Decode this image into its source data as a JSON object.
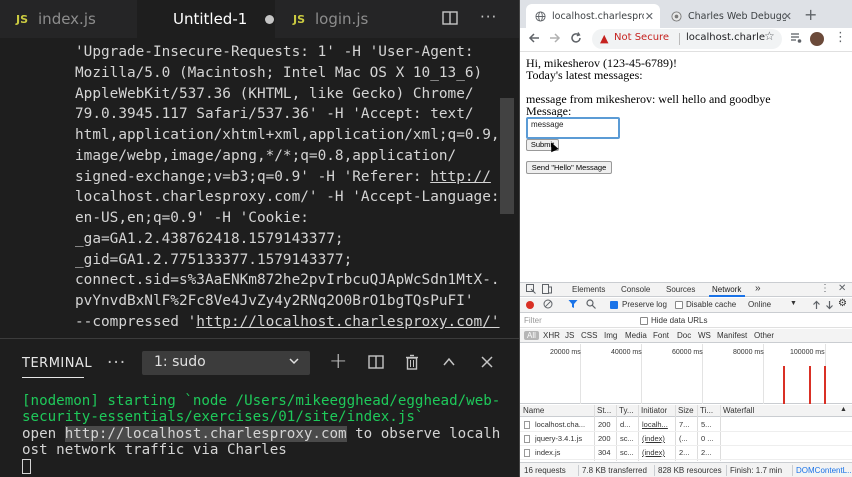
{
  "editor": {
    "tabs": [
      {
        "icon_label": "JS",
        "label": "index.js"
      },
      {
        "label": "Untitled-1"
      },
      {
        "icon_label": "JS",
        "label": "login.js"
      }
    ],
    "code_lines": [
      "'Upgrade-Insecure-Requests: 1' -H 'User-Agent:",
      "Mozilla/5.0 (Macintosh; Intel Mac OS X 10_13_6)",
      "AppleWebKit/537.36 (KHTML, like Gecko) Chrome/",
      "79.0.3945.117 Safari/537.36' -H 'Accept: text/",
      "html,application/xhtml+xml,application/xml;q=0.9,",
      "image/webp,image/apng,*/*;q=0.8,application/",
      "signed-exchange;v=b3;q=0.9' -H 'Referer: ",
      "localhost.charlesproxy.com/' -H 'Accept-Language:",
      "en-US,en;q=0.9' -H 'Cookie:",
      "_ga=GA1.2.438762418.1579143377;",
      "_gid=GA1.2.775133377.1579143377;",
      "connect.sid=s%3AaENKm872he2pvIrbcuQJApWcSdn1MtX-.",
      "pvYnvdBxNlF%2Fc8Ve4JvZy4y2RNq2O0BrO1bgTQsPuFI'",
      "--compressed '"
    ],
    "code_link_referer": "http://",
    "code_link_compressed": "http://localhost.charlesproxy.com/'",
    "terminal": {
      "title": "TERMINAL",
      "more": "···",
      "shell_select": "1: sudo",
      "lines": [
        "[nodemon] starting `node /Users/mikeegghead/egghead/web-",
        "security-essentials/exercises/01/site/index.js`"
      ],
      "open_prefix": "open ",
      "open_url": "http://localhost.charlesproxy.com",
      "open_suffix": " to observe localh",
      "open_line2": "ost network traffic via Charles"
    }
  },
  "browser": {
    "tabs": [
      {
        "title": "localhost.charlesproxy.c"
      },
      {
        "title": "Charles Web Debugging"
      }
    ],
    "omnibox": {
      "security": "Not Secure",
      "url": "localhost.charle..."
    },
    "page": {
      "greeting": "Hi, mikesherov (123-45-6789)!",
      "latest": "Today's latest messages:",
      "message": "message from mikesherov: well hello and goodbye",
      "message_label": "Message:",
      "textarea_value": "message",
      "submit": "Submit",
      "hello_button": "Send \"Hello\" Message"
    },
    "devtools": {
      "tabs": [
        "Elements",
        "Console",
        "Sources",
        "Network"
      ],
      "more": "»",
      "preserve_log": "Preserve log",
      "disable_cache": "Disable cache",
      "throttle": "Online",
      "filter_placeholder": "Filter",
      "hide_data_urls": "Hide data URLs",
      "types": [
        "All",
        "XHR",
        "JS",
        "CSS",
        "Img",
        "Media",
        "Font",
        "Doc",
        "WS",
        "Manifest",
        "Other"
      ],
      "overview_ticks": [
        "20000 ms",
        "40000 ms",
        "60000 ms",
        "80000 ms",
        "100000 ms"
      ],
      "columns": [
        "Name",
        "St...",
        "Ty...",
        "Initiator",
        "Size",
        "Ti...",
        "Waterfall"
      ],
      "rows": [
        {
          "name": "localhost.cha...",
          "status": "200",
          "type": "d...",
          "initiator": "localh...",
          "size": "7...",
          "time": "5..."
        },
        {
          "name": "jquery-3.4.1.js",
          "status": "200",
          "type": "sc...",
          "initiator": "(index)",
          "size": "(...",
          "time": "0 ..."
        },
        {
          "name": "index.js",
          "status": "304",
          "type": "sc...",
          "initiator": "(index)",
          "size": "2...",
          "time": "2..."
        }
      ],
      "status": {
        "requests": "16 requests",
        "transferred": "7.8 KB transferred",
        "resources": "828 KB resources",
        "finish": "Finish: 1.7 min",
        "dcl": "DOMContentL..."
      }
    }
  }
}
